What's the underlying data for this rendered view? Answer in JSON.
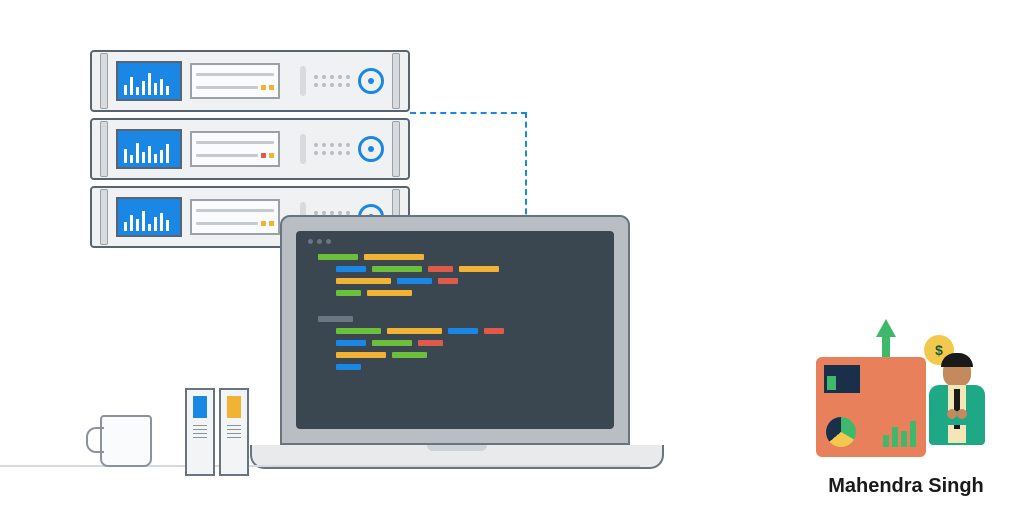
{
  "signature": {
    "name": "Mahendra Singh",
    "speech_symbol": "$"
  },
  "colors": {
    "blue": "#1b87e5",
    "green": "#6bbf3a",
    "yellow": "#f2b233",
    "red": "#e05a4a",
    "dark": "#3a4650",
    "gray": "#b8bec4"
  }
}
